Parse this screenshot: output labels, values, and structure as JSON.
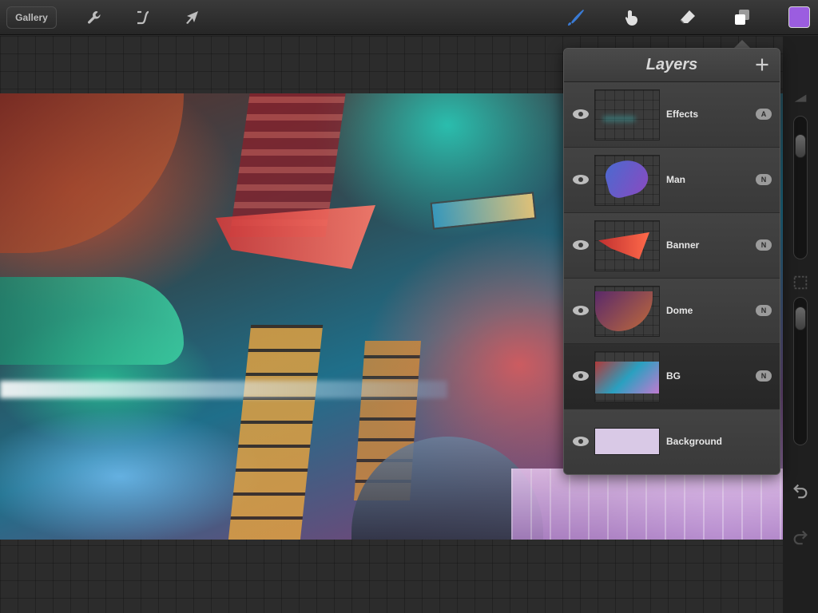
{
  "toolbar": {
    "gallery_label": "Gallery",
    "tools": [
      {
        "name": "actions",
        "icon": "wrench-icon"
      },
      {
        "name": "adjustments",
        "icon": "curve-icon"
      },
      {
        "name": "selection",
        "icon": "arrow-cursor-icon"
      },
      {
        "name": "brush",
        "icon": "brush-icon",
        "active": true
      },
      {
        "name": "smudge",
        "icon": "smudge-finger-icon"
      },
      {
        "name": "eraser",
        "icon": "eraser-icon"
      },
      {
        "name": "layers",
        "icon": "layers-icon"
      }
    ],
    "current_color": "#9b5de0",
    "active_tool_color": "#3a7bd5"
  },
  "layers_panel": {
    "title": "Layers",
    "add_icon": "plus-icon",
    "layers": [
      {
        "name": "Effects",
        "blend": "A",
        "visible": true,
        "selected": false
      },
      {
        "name": "Man",
        "blend": "N",
        "visible": true,
        "selected": false
      },
      {
        "name": "Banner",
        "blend": "N",
        "visible": true,
        "selected": false
      },
      {
        "name": "Dome",
        "blend": "N",
        "visible": true,
        "selected": false
      },
      {
        "name": "BG",
        "blend": "N",
        "visible": true,
        "selected": true
      },
      {
        "name": "Background",
        "blend": "",
        "visible": true,
        "selected": false,
        "color": "#d9c9e6"
      }
    ]
  },
  "sidebar": {
    "brush_size": 0.85,
    "brush_opacity": 0.92,
    "icons": [
      "brush-size-icon",
      "opacity-icon",
      "undo-icon",
      "redo-icon"
    ]
  }
}
